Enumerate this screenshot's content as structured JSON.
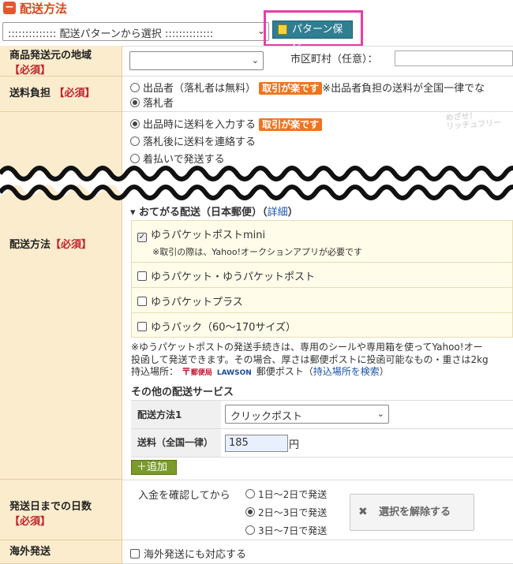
{
  "section": {
    "icon": "minus-icon",
    "title": "配送方法"
  },
  "pattern": {
    "select_value": ":::::::::::::: 配送パターンから選択 ::::::::::::::",
    "save_label": "パターン保存",
    "save_icon": "floppy-disk-icon"
  },
  "origin": {
    "label": "商品発送元の地域",
    "required": "【必須】",
    "city_label": "市区町村（任意）："
  },
  "burden": {
    "label": "送料負担",
    "required": "【必須】",
    "options": [
      {
        "label": "出品者（落札者は無料）",
        "badge": "取引が楽です",
        "note": "※出品者負担の送料が全国一律でな",
        "selected": false
      },
      {
        "label": "落札者",
        "selected": true
      }
    ]
  },
  "shipping": {
    "label": "配送方法",
    "required": "【必須】",
    "timing_options": [
      {
        "label": "出品時に送料を入力する",
        "badge": "取引が楽です",
        "selected": true
      },
      {
        "label": "落札後に送料を連絡する",
        "selected": false
      },
      {
        "label": "着払いで発送する",
        "selected": false
      }
    ],
    "stamp_line1": "めざせ！",
    "stamp_line2": "リッチュフリー",
    "otegaru_title": "▾ おてがる配送（日本郵便）",
    "otegaru_link": "詳細",
    "methods": [
      {
        "label": "ゆうパケットポストmini",
        "checked": true,
        "note": "※取引の際は、Yahoo!オークションアプリが必要です"
      },
      {
        "label": "ゆうパケット・ゆうパケットポスト",
        "checked": false
      },
      {
        "label": "ゆうパケットプラス",
        "checked": false
      },
      {
        "label": "ゆうパック（60〜170サイズ）",
        "checked": false
      }
    ],
    "info_line1": "※ゆうパケットポストの発送手続きは、専用のシールや専用箱を使ってYahoo!オー",
    "info_line2": "投函して発送できます。その場合、厚さは郵便ポストに投函可能なもの・重さは2kg",
    "drop_label": "持込場所：",
    "jp_logo": "郵便局",
    "lawson_logo": "LAWSON",
    "post_text": "郵便ポスト（",
    "search_link": "持込場所を検索",
    "post_close": "）",
    "other_title": "その他の配送サービス",
    "other_method_label": "配送方法1",
    "other_method_value": "クリックポスト",
    "fee_label": "送料（全国一律）",
    "fee_value": "185",
    "fee_unit": "円",
    "add_label": "＋追加"
  },
  "days": {
    "label": "発送日までの日数",
    "required": "【必須】",
    "condition": "入金を確認してから",
    "options": [
      {
        "label": "1日〜2日で発送",
        "selected": false
      },
      {
        "label": "2日〜3日で発送",
        "selected": true
      },
      {
        "label": "3日〜7日で発送",
        "selected": false
      }
    ],
    "clear_label": "選択を解除する"
  },
  "overseas": {
    "label": "海外発送",
    "option": "海外発送にも対応する"
  }
}
